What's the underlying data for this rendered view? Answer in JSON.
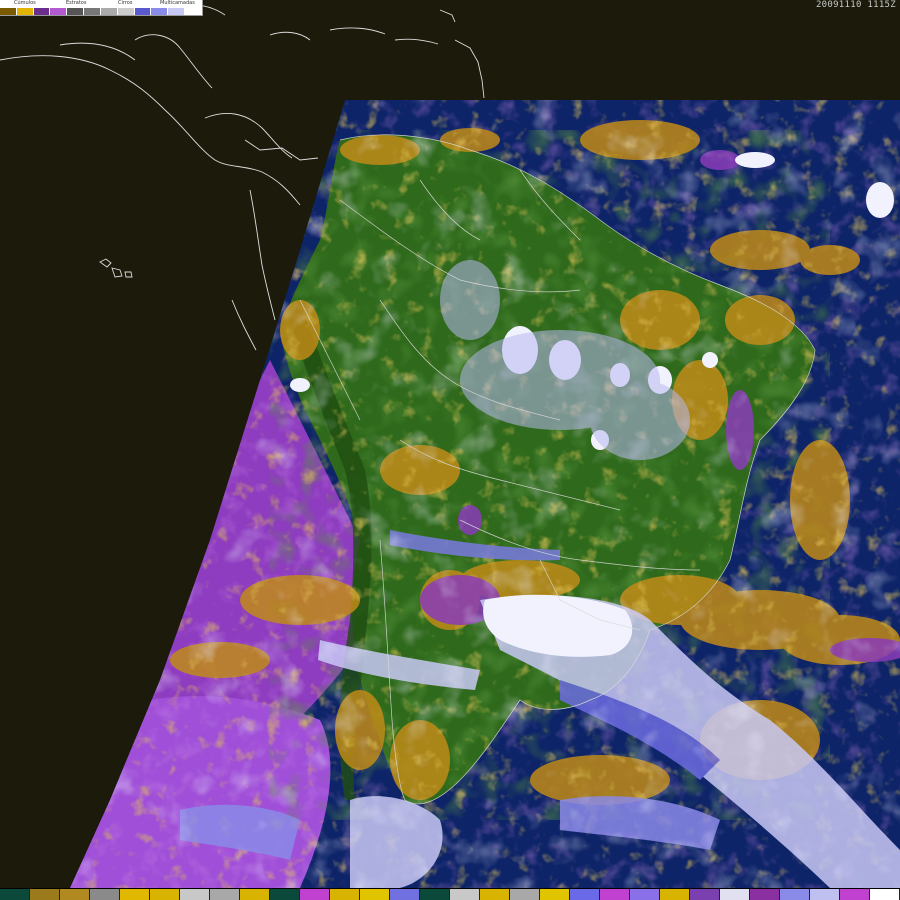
{
  "image": {
    "timestamp": "20091110 1115Z"
  },
  "legend": {
    "labels": [
      "Cúmulos",
      "Estratos",
      "Cirros",
      "Multicamadas"
    ],
    "swatches": [
      "#7a5a00",
      "#e0b400",
      "#6a2f8c",
      "#b45ad0",
      "#555555",
      "#777777",
      "#aaaaaa",
      "#cccccc",
      "#5a5ad0",
      "#8a8ae8",
      "#c8c8f4",
      "#ffffff"
    ]
  },
  "colorbar": {
    "swatches": [
      "#0b4a3a",
      "#9a7a1a",
      "#b08a20",
      "#8a8a8a",
      "#e0b800",
      "#d8b400",
      "#c8c8c8",
      "#a8a8a8",
      "#d8b400",
      "#0b4a3a",
      "#c040d0",
      "#d8b400",
      "#e0c400",
      "#7070e0",
      "#0b4a3a",
      "#c8c8c8",
      "#d8b400",
      "#a8a8a8",
      "#e0c400",
      "#6a6ae8",
      "#c040d0",
      "#8a70e8",
      "#d8b400",
      "#7a40b0",
      "#e0e0f0",
      "#8a30a0",
      "#8a8ae8",
      "#c0c0f0",
      "#c040d0",
      "#ffffff"
    ]
  },
  "colors": {
    "space": "#1c1a0b",
    "ocean": "#0e2468",
    "land_green": "#2f6a1c",
    "land_dark": "#1f5512",
    "cumulus": "#c08a18",
    "stratus_purple": "#8e3cc0",
    "cirrus_light": "#c8c8f4",
    "cloud_white": "#f2f2ff",
    "coast": "#e8e8e8"
  }
}
